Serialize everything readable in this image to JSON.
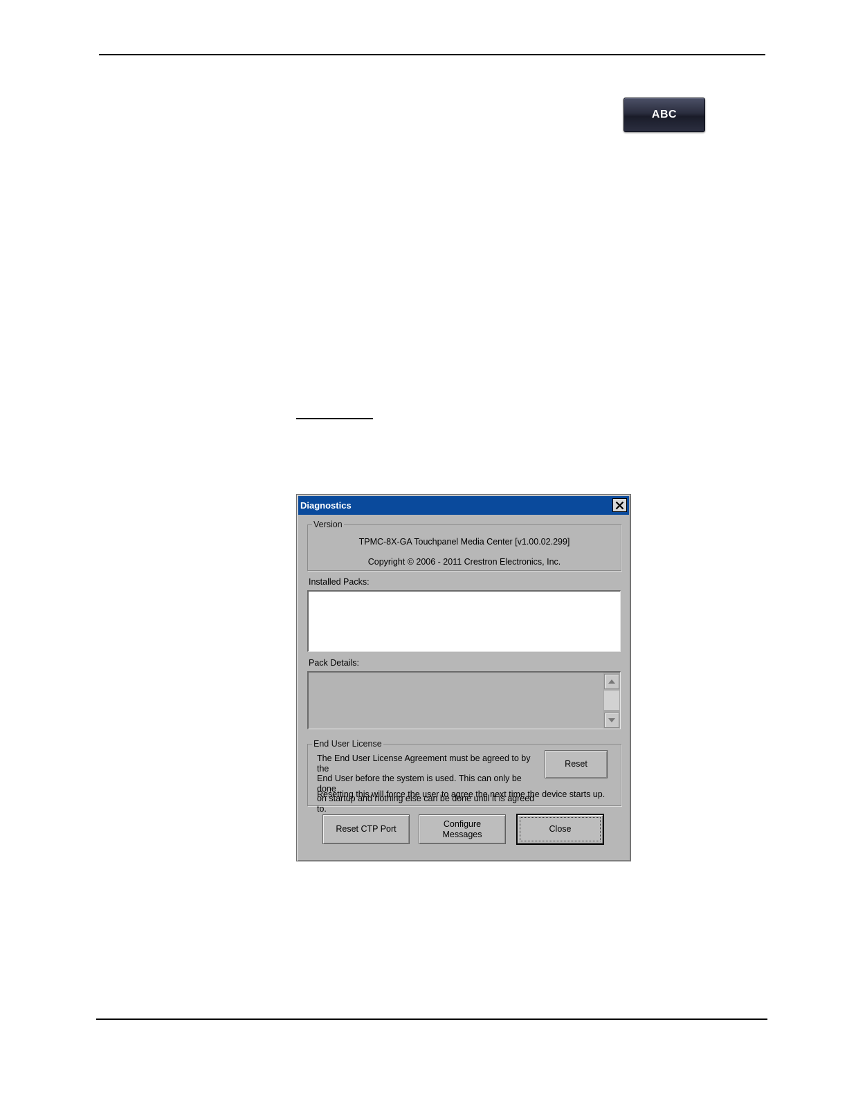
{
  "toolbar": {
    "abc_button_label": "ABC"
  },
  "dialog": {
    "title": "Diagnostics",
    "version": {
      "legend": "Version",
      "product_line": "TPMC-8X-GA Touchpanel Media Center [v1.00.02.299]",
      "copyright_line": "Copyright © 2006 - 2011 Crestron Electronics, Inc."
    },
    "installed_packs": {
      "label": "Installed Packs:",
      "items": []
    },
    "pack_details": {
      "label": "Pack Details:",
      "text": ""
    },
    "eula": {
      "legend": "End User License",
      "line1": "The End User License Agreement must be agreed to by the",
      "line2": "End User before the system is used.  This can only be done",
      "line3": "on startup and nothing else can be done until it is agreed to.",
      "line4": "Resetting this will force the user to agree the next time the device starts up.",
      "reset_label": "Reset"
    },
    "buttons": {
      "reset_ctp_port": "Reset CTP Port",
      "configure_line1": "Configure",
      "configure_line2": "Messages",
      "close": "Close"
    }
  }
}
